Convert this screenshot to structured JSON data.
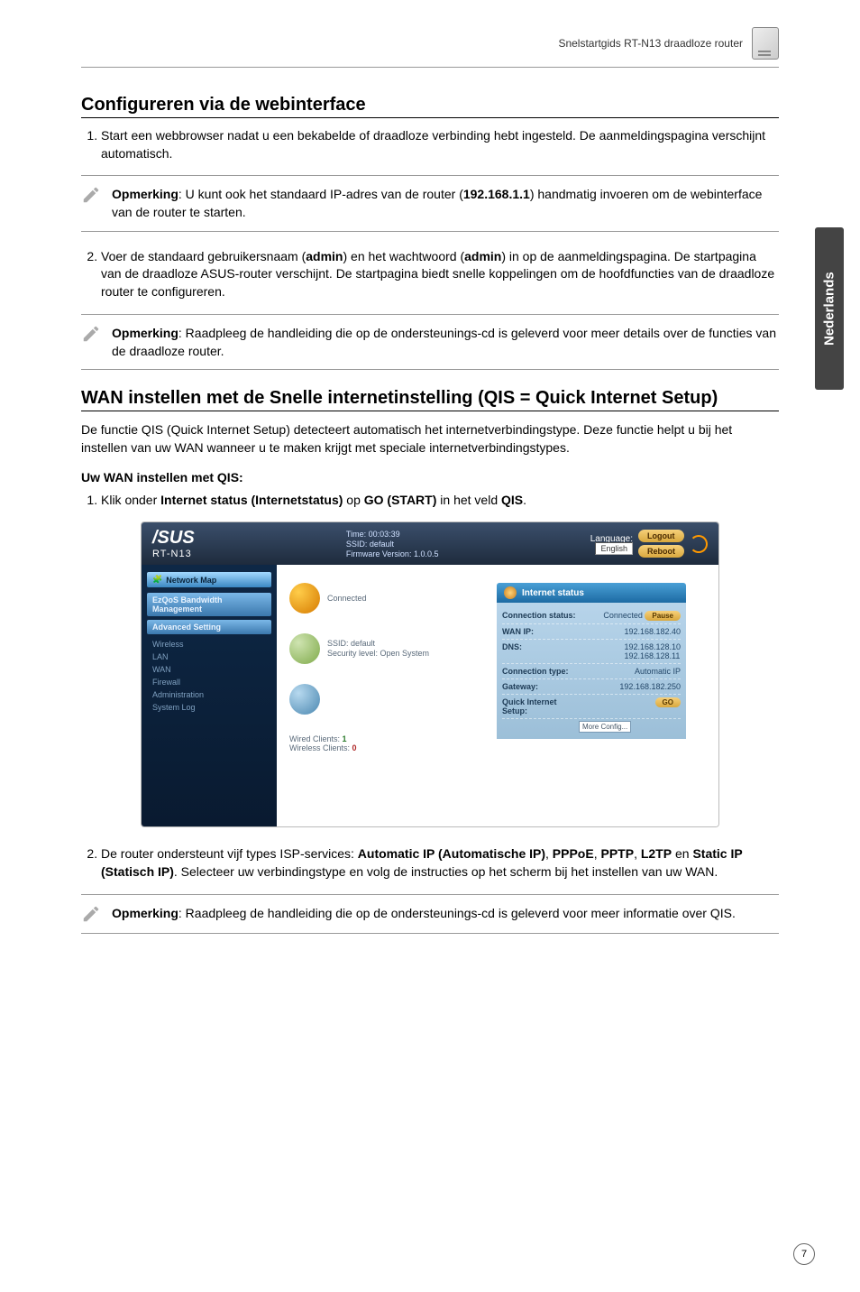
{
  "top_header": "Snelstartgids RT-N13 draadloze router",
  "section1": {
    "title": "Configureren via de webinterface",
    "step1": "Start een webbrowser nadat u een bekabelde of draadloze verbinding hebt ingesteld. De aanmeldingspagina verschijnt automatisch.",
    "note1_label": "Opmerking",
    "note1": ": U kunt ook het standaard IP-adres van de router (",
    "note1_ip": "192.168.1.1",
    "note1_tail": ") handmatig invoeren om de webinterface van de router te starten.",
    "step2_a": "Voer de standaard gebruikersnaam (",
    "step2_admin1": "admin",
    "step2_b": ") en het wachtwoord (",
    "step2_admin2": "admin",
    "step2_c": ") in op de aanmeldingspagina. De startpagina van de draadloze ASUS-router verschijnt. De startpagina biedt snelle koppelingen om de hoofdfuncties van de draadloze router te configureren.",
    "note2_label": "Opmerking",
    "note2": ": Raadpleeg de handleiding die op de ondersteunings-cd is geleverd voor meer details over de functies van de draadloze router."
  },
  "section2": {
    "title": "WAN instellen met de Snelle internetinstelling (QIS = Quick Internet Setup)",
    "intro": "De functie QIS (Quick Internet Setup) detecteert automatisch het internetverbindingstype. Deze functie helpt u bij het instellen van uw WAN wanneer u te maken krijgt met speciale internetverbindingstypes.",
    "sub": "Uw WAN instellen met QIS:",
    "step1_a": "Klik onder ",
    "step1_b": "Internet status (Internetstatus)",
    "step1_c": " op ",
    "step1_d": "GO (START)",
    "step1_e": " in het veld ",
    "step1_f": "QIS",
    "step1_g": ".",
    "step2_a": "De router ondersteunt vijf types ISP-services: ",
    "step2_auto": "Automatic IP (Automatische IP)",
    "step2_pppoe": "PPPoE",
    "step2_pptp": "PPTP",
    "step2_l2tp": "L2TP",
    "step2_en": " en ",
    "step2_static": "Static IP (Statisch IP)",
    "step2_b": ". Selecteer uw verbindingstype en volg de instructies op het scherm bij het instellen van uw WAN.",
    "note_label": "Opmerking",
    "note": ": Raadpleeg de handleiding die op de ondersteunings-cd is geleverd voor meer informatie over QIS."
  },
  "side_tab": "Nederlands",
  "screenshot": {
    "brand": "/SUS",
    "model": "RT-N13",
    "time": "Time: 00:03:39",
    "ssid": "SSID: default",
    "fw": "Firmware Version: 1.0.0.5",
    "language_label": "Language:",
    "language_value": "English",
    "logout": "Logout",
    "reboot": "Reboot",
    "side_map": "Network Map",
    "side_ezqos": "EzQoS Bandwidth Management",
    "side_adv": "Advanced Setting",
    "side_wireless": "Wireless",
    "side_lan": "LAN",
    "side_wan": "WAN",
    "side_firewall": "Firewall",
    "side_admin": "Administration",
    "side_log": "System Log",
    "center_connected": "Connected",
    "center_ssid": "SSID: default",
    "center_sec": "Security level: Open System",
    "center_wired": "Wired Clients:",
    "center_wired_n": "1",
    "center_wireless": "Wireless Clients:",
    "center_wireless_n": "0",
    "status_title": "Internet status",
    "row_conn": "Connection status:",
    "row_conn_val": "Connected",
    "row_conn_btn": "Pause",
    "row_wanip": "WAN IP:",
    "row_wanip_val": "192.168.182.40",
    "row_dns": "DNS:",
    "row_dns_val1": "192.168.128.10",
    "row_dns_val2": "192.168.128.11",
    "row_ctype": "Connection type:",
    "row_ctype_val": "Automatic IP",
    "row_gw": "Gateway:",
    "row_gw_val": "192.168.182.250",
    "row_qis": "Quick Internet Setup:",
    "row_qis_btn": "GO",
    "row_more": "More Config..."
  },
  "page_number": "7"
}
